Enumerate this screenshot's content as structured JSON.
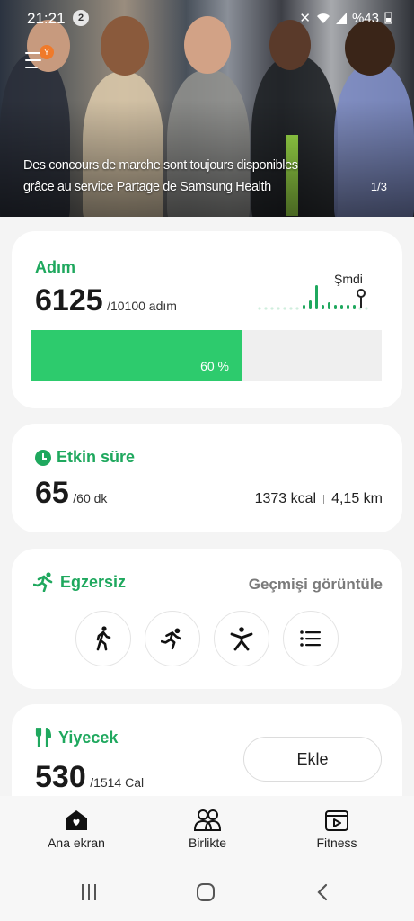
{
  "status_bar": {
    "time": "21:21",
    "notification_count": "2",
    "battery": "%43"
  },
  "hero": {
    "caption_line1": "Des concours de marche sont toujours disponibles",
    "caption_line2": "grâce au service Partage de Samsung Health",
    "pager": "1/3",
    "menu_badge": "Y"
  },
  "steps": {
    "title": "Adım",
    "value": "6125",
    "goal": "/10100 adım",
    "now_label": "Şmdi",
    "progress_percent": 60,
    "progress_label": "60 %"
  },
  "active_time": {
    "title": "Etkin süre",
    "value": "65",
    "goal": "/60 dk",
    "calories": "1373 kcal",
    "distance": "4,15 km"
  },
  "exercise": {
    "title": "Egzersiz",
    "history_link": "Geçmişi görüntüle",
    "buttons": [
      {
        "icon": "walking-icon"
      },
      {
        "icon": "running-icon"
      },
      {
        "icon": "workout-icon"
      },
      {
        "icon": "list-icon"
      }
    ]
  },
  "food": {
    "title": "Yiyecek",
    "value": "530",
    "goal": "/1514 Cal",
    "add_label": "Ekle"
  },
  "bottom_nav": {
    "items": [
      {
        "label": "Ana ekran",
        "icon": "home-icon"
      },
      {
        "label": "Birlikte",
        "icon": "people-icon"
      },
      {
        "label": "Fitness",
        "icon": "fitness-video-icon"
      }
    ]
  },
  "colors": {
    "accent_green": "#1fa85e",
    "progress_green": "#2dcb6d",
    "menu_badge": "#f07a2a"
  }
}
